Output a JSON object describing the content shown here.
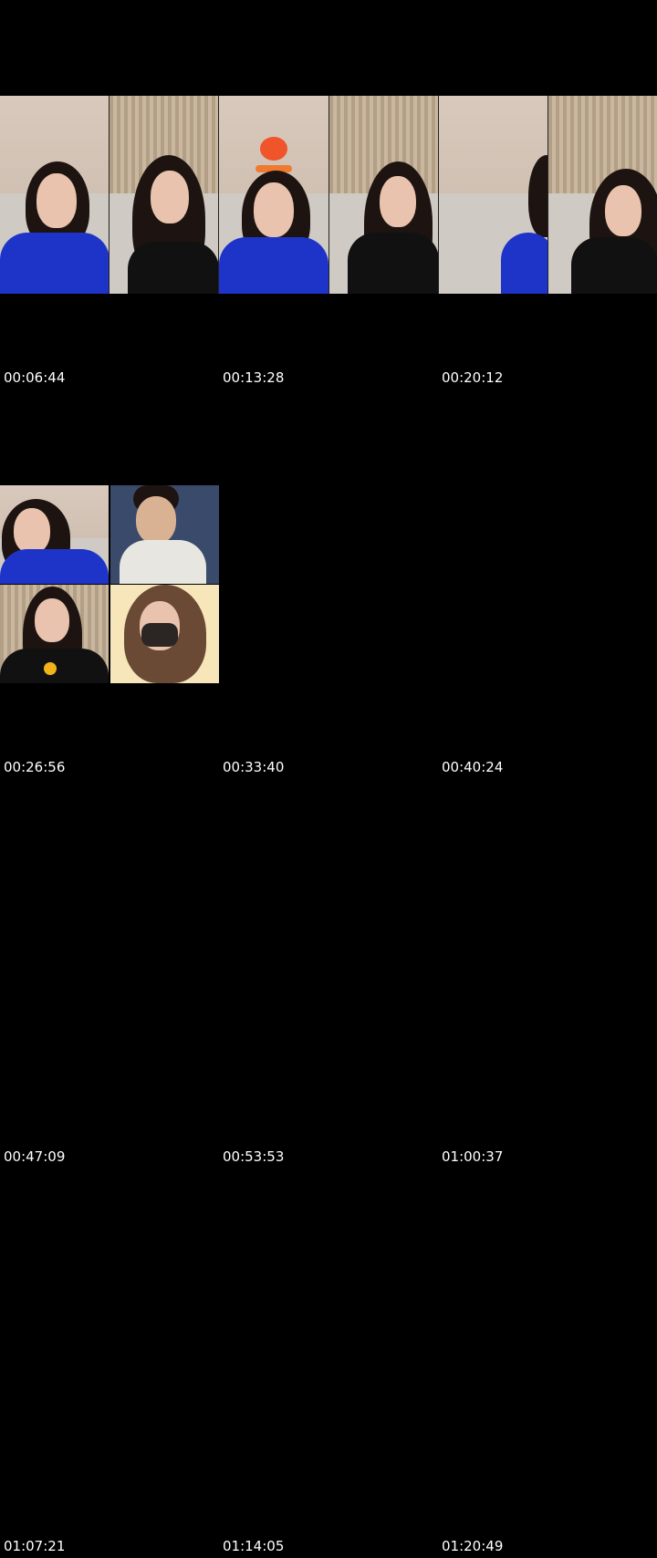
{
  "timestamps": [
    "00:06:44",
    "00:13:28",
    "00:20:12",
    "00:26:56",
    "00:33:40",
    "00:40:24",
    "00:47:09",
    "00:53:53",
    "01:00:37",
    "01:07:21",
    "01:14:05",
    "01:20:49"
  ],
  "colors": {
    "background": "#000000",
    "timestamp_text": "#ffffff"
  }
}
